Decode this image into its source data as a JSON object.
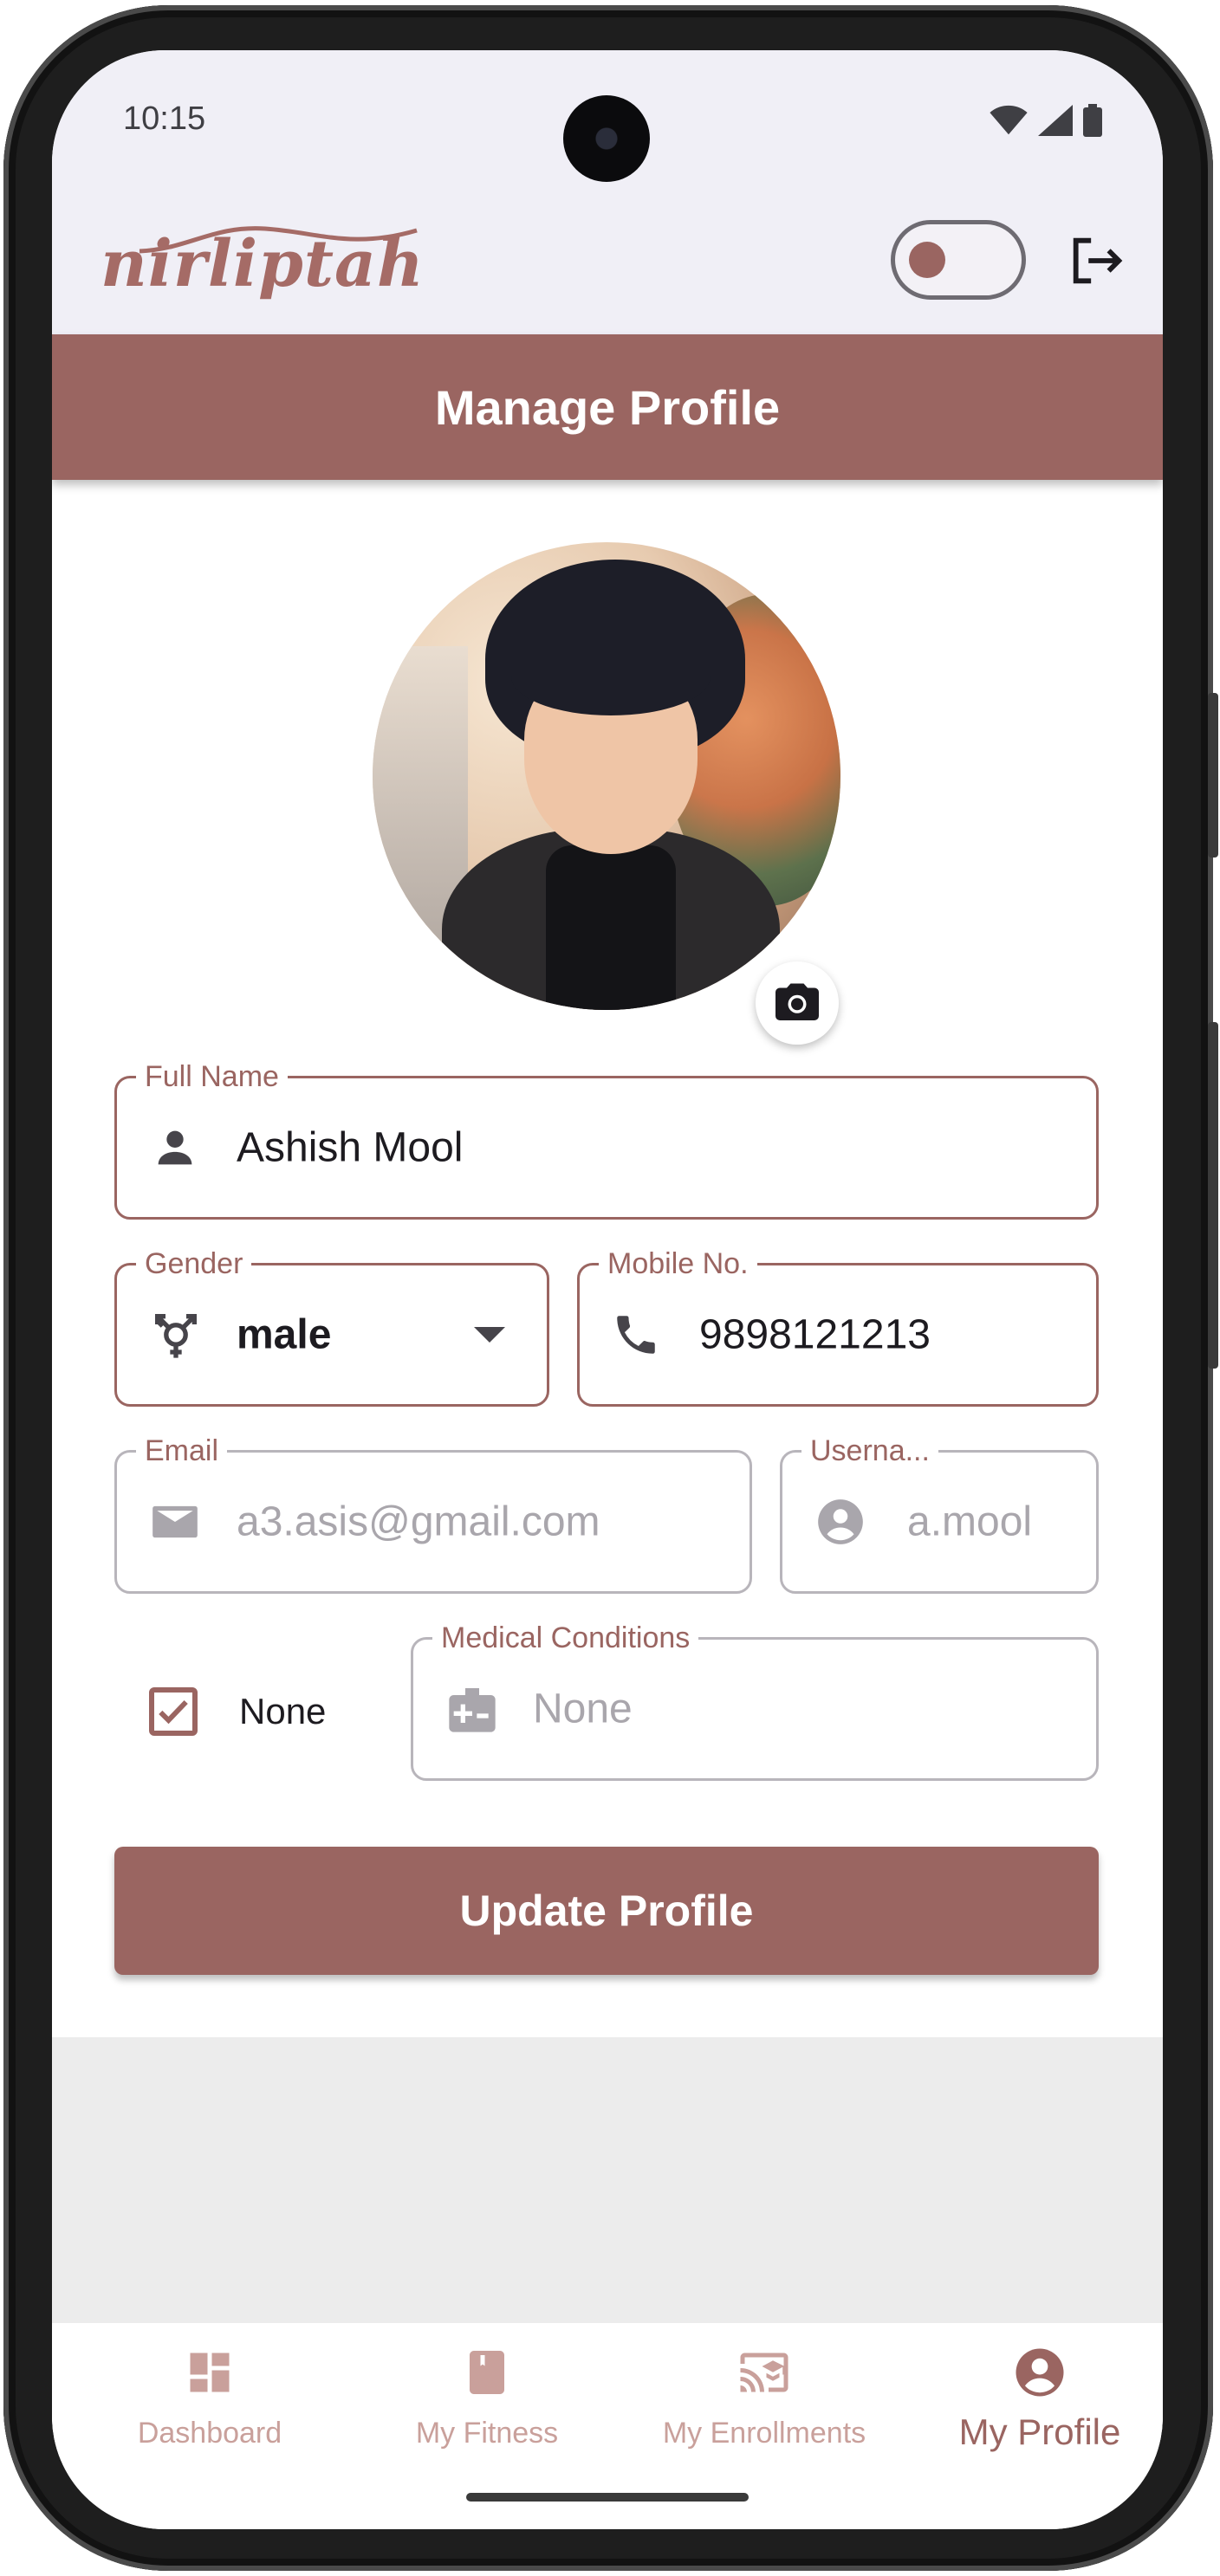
{
  "status_bar": {
    "time": "10:15"
  },
  "app_bar": {
    "logo_text": "nirliptah"
  },
  "page": {
    "title": "Manage Profile"
  },
  "form": {
    "full_name": {
      "label": "Full Name",
      "value": "Ashish Mool"
    },
    "gender": {
      "label": "Gender",
      "value": "male"
    },
    "mobile": {
      "label": "Mobile No.",
      "value": "9898121213"
    },
    "email": {
      "label": "Email",
      "value": "a3.asis@gmail.com"
    },
    "username": {
      "label": "Userna...",
      "value": "a.mool"
    },
    "none_checkbox": {
      "label": "None",
      "checked": true
    },
    "medical_conditions": {
      "label": "Medical Conditions",
      "value": "None"
    },
    "submit_label": "Update Profile"
  },
  "bottom_nav": {
    "items": [
      {
        "label": "Dashboard",
        "icon": "dashboard-icon",
        "active": false
      },
      {
        "label": "My Fitness",
        "icon": "book-icon",
        "active": false
      },
      {
        "label": "My Enrollments",
        "icon": "cast-for-education-icon",
        "active": false
      },
      {
        "label": "My Profile",
        "icon": "account-circle-icon",
        "active": true
      }
    ]
  },
  "colors": {
    "primary": "#9a6561",
    "app_bar_bg": "#f0eff6",
    "inactive_nav": "#c9a09b",
    "disabled_border": "#b8b5bb"
  }
}
